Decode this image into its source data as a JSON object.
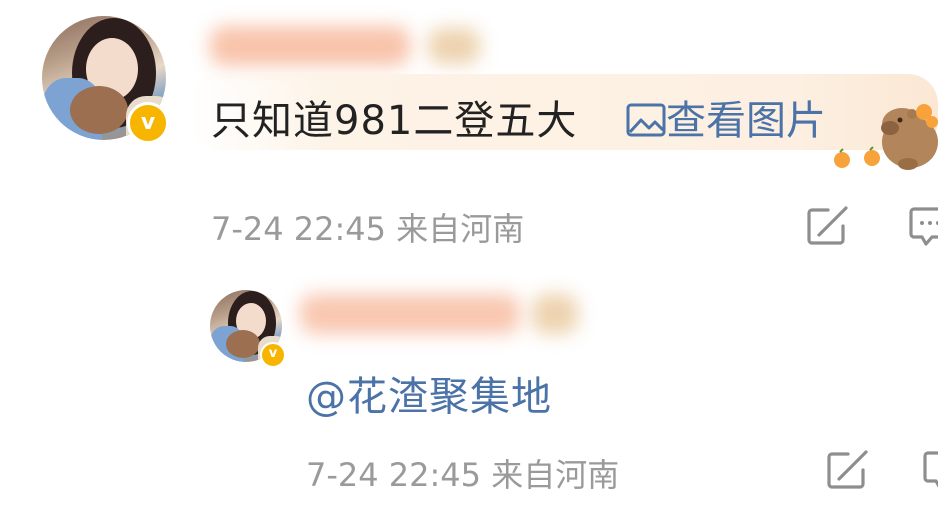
{
  "comment": {
    "text": "只知道981二登五大",
    "picture_link": "查看图片",
    "meta": "7-24 22:45 来自河南",
    "verified_badge": "v"
  },
  "reply": {
    "mention": "@花渣聚集地",
    "meta": "7-24 22:45 来自河南",
    "verified_badge": "v"
  },
  "colors": {
    "link": "#4b73a8",
    "verified": "#f7b500",
    "meta_text": "#9a9a9a",
    "body_text": "#222222"
  },
  "icons": [
    "edit-icon",
    "comment-icon",
    "image-icon",
    "capybara-sticker"
  ]
}
